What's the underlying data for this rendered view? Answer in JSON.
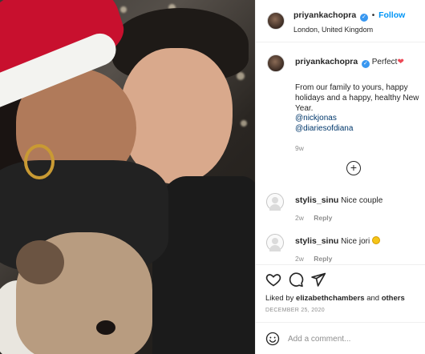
{
  "post": {
    "author": "priyankachopra",
    "follow_label": "Follow",
    "separator": "•",
    "location": "London, United Kingdom"
  },
  "caption": {
    "author": "priyankachopra",
    "first_word": "Perfect",
    "text": "From our family to yours, happy holidays and a happy, healthy New Year.",
    "mentions": [
      "@nickjonas",
      "@diariesofdiana"
    ],
    "time": "9w"
  },
  "comments": [
    {
      "author": "stylis_sinu",
      "text": "Nice couple",
      "time": "2w",
      "reply_label": "Reply"
    },
    {
      "author": "stylis_sinu",
      "text": "Nice jori",
      "time": "2w",
      "reply_label": "Reply"
    }
  ],
  "engagement": {
    "liked_prefix": "Liked by",
    "liked_user": "elizabethchambers",
    "liked_join": "and",
    "liked_others": "others",
    "date": "DECEMBER 25, 2020"
  },
  "composer": {
    "placeholder": "Add a comment..."
  },
  "icons": {
    "verified": "verified-badge-icon",
    "heart": "heart-icon",
    "comment": "comment-icon",
    "share": "share-icon",
    "emoji": "emoji-icon",
    "more": "plus-circle-icon"
  },
  "colors": {
    "accent": "#0095f6",
    "verified": "#3897f0",
    "heart": "#ed4956",
    "muted": "#8e8e8e"
  }
}
